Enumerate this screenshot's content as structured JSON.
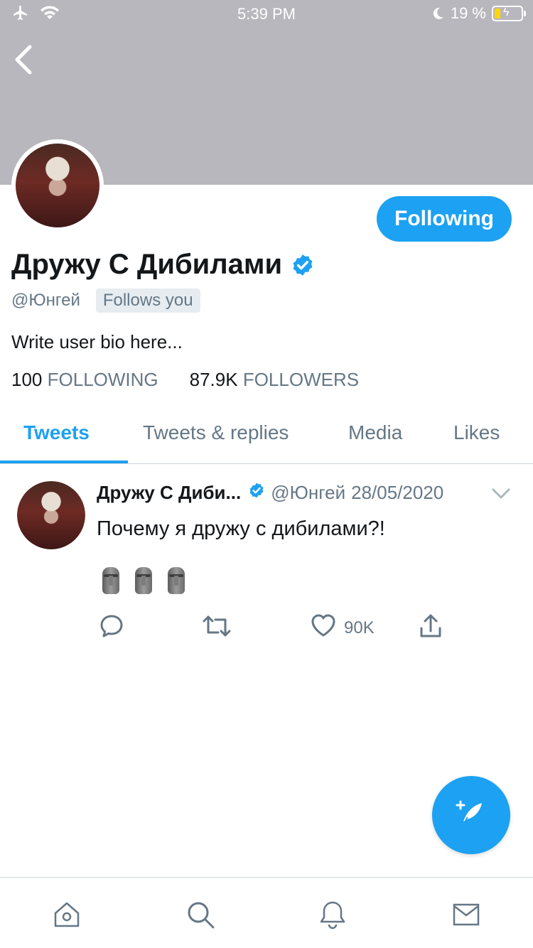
{
  "status_bar": {
    "time": "5:39 PM",
    "battery": "19 %"
  },
  "profile": {
    "display_name": "Дружу С Дибилами",
    "handle": "@Юнгей",
    "follows_you": "Follows you",
    "follow_button": "Following",
    "bio": "Write user bio here...",
    "following_count": "100",
    "following_label": "FOLLOWING",
    "followers_count": "87.9K",
    "followers_label": "FOLLOWERS"
  },
  "tabs": [
    {
      "label": "Tweets",
      "active": true
    },
    {
      "label": "Tweets & replies",
      "active": false
    },
    {
      "label": "Media",
      "active": false
    },
    {
      "label": "Likes",
      "active": false
    }
  ],
  "tweet": {
    "name": "Дружу С Диби...",
    "handle": "@Юнгей",
    "date": "28/05/2020",
    "text": "Почему я дружу с дибилами?!",
    "emoji": [
      "moai",
      "moai",
      "moai"
    ],
    "like_count": "90K"
  },
  "colors": {
    "accent": "#1da1f2",
    "banner": "#b8b7bd",
    "muted": "#657786"
  },
  "icons": [
    "airplane-icon",
    "wifi-icon",
    "moon-icon",
    "battery-icon",
    "back-chevron-icon",
    "verified-icon",
    "reply-icon",
    "retweet-icon",
    "like-icon",
    "share-icon",
    "compose-icon",
    "home-icon",
    "search-icon",
    "notifications-icon",
    "messages-icon"
  ]
}
